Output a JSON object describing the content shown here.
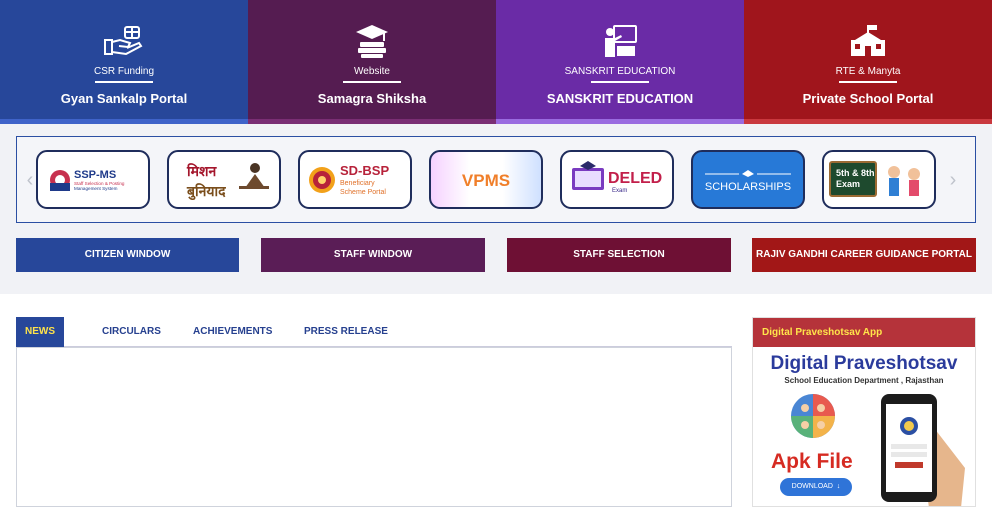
{
  "colors": {
    "csr": "#27479a",
    "samagra": "#551c51",
    "sanskrit": "#6a2ba6",
    "rte": "#a0151c",
    "citizen": "#27479a",
    "staff_window": "#5a1d56",
    "staff_selection": "#6e1034",
    "career": "#a21717",
    "news_active": "#27479a"
  },
  "tiles": [
    {
      "icon": "hand-heart-icon",
      "caption": "CSR Funding",
      "title": "Gyan Sankalp Portal"
    },
    {
      "icon": "books-graduation-icon",
      "caption": "Website",
      "title": "Samagra Shiksha"
    },
    {
      "icon": "teacher-board-icon",
      "caption": "SANSKRIT EDUCATION",
      "title": "SANSKRIT EDUCATION"
    },
    {
      "icon": "school-building-icon",
      "caption": "RTE & Manyta",
      "title": "Private School Portal"
    }
  ],
  "carousel": {
    "items": [
      {
        "name": "ssp-ms",
        "title": "SSP-MS",
        "line1": "Staff Selection & Posting",
        "line2": "Management System"
      },
      {
        "name": "mission-buniyaad",
        "title": "मिशन",
        "line1": "बुनियाद",
        "line2": ""
      },
      {
        "name": "sd-bsp",
        "title": "SD-BSP",
        "line1": "Beneficiary",
        "line2": "Scheme Portal"
      },
      {
        "name": "vpms",
        "title": "VPMS",
        "line1": "",
        "line2": ""
      },
      {
        "name": "deled",
        "title": "DELED",
        "line1": "Exam",
        "line2": ""
      },
      {
        "name": "scholarships",
        "title": "SCHOLARSHIPS",
        "line1": "",
        "line2": ""
      },
      {
        "name": "exam-5-8",
        "title": "5th & 8th",
        "line1": "Exam",
        "line2": ""
      }
    ]
  },
  "windows": [
    {
      "label": "CITIZEN WINDOW"
    },
    {
      "label": "STAFF WINDOW"
    },
    {
      "label": "STAFF SELECTION"
    },
    {
      "label": "RAJIV GANDHI CAREER GUIDANCE PORTAL"
    }
  ],
  "news": {
    "tabs": [
      {
        "label": "NEWS",
        "active": true
      },
      {
        "label": "CIRCULARS",
        "active": false
      },
      {
        "label": "ACHIEVEMENTS",
        "active": false
      },
      {
        "label": "PRESS RELEASE",
        "active": false
      }
    ]
  },
  "app": {
    "header": "Digital Praveshotsav App",
    "title": "Digital Praveshotsav",
    "subtitle": "School Education Department , Rajasthan",
    "apk": "Apk File",
    "download": "DOWNLOAD"
  }
}
